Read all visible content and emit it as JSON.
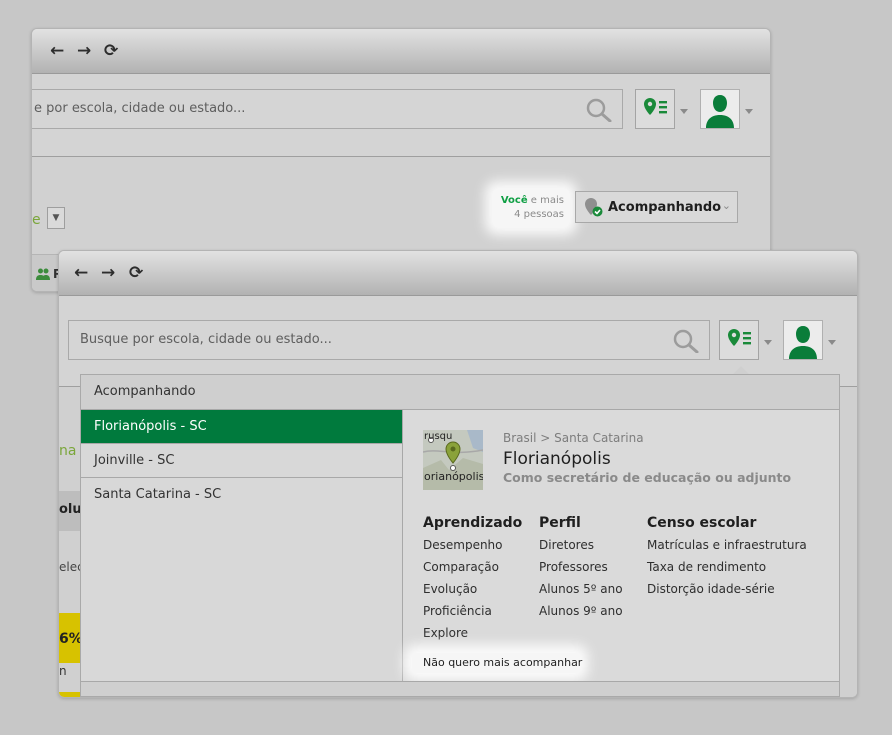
{
  "colors": {
    "accent": "#007a3d",
    "brand_green": "#009a3d",
    "chart_yellow": "#d7c200",
    "link_green": "#7aa63a"
  },
  "back_window": {
    "search": {
      "placeholder": "e por escola, cidade ou estado..."
    },
    "followers": {
      "you": "Você",
      "and_more": "e mais",
      "count": "4 pessoas"
    },
    "follow_button": {
      "label": "Acompanhando"
    },
    "cut_text": {
      "left_link": "e",
      "tab_letter": "P"
    }
  },
  "front_window": {
    "search": {
      "placeholder": "Busque por escola, cidade ou estado..."
    },
    "dropdown": {
      "header": "Acompanhando",
      "items": [
        {
          "label": "Florianópolis - SC",
          "selected": true
        },
        {
          "label": "Joinville - SC",
          "selected": false
        },
        {
          "label": "Santa Catarina - SC",
          "selected": false
        }
      ],
      "detail": {
        "breadcrumb": "Brasil > Santa Catarina",
        "city": "Florianópolis",
        "role": "Como secretário de educação ou adjunto",
        "map_labels": {
          "top": "rusqu",
          "bottom": "lorianópolis"
        },
        "columns": [
          {
            "title": "Aprendizado",
            "links": [
              "Desempenho",
              "Comparação",
              "Evolução",
              "Proficiência",
              "Explore"
            ]
          },
          {
            "title": "Perfil",
            "links": [
              "Diretores",
              "Professores",
              "Alunos 5º ano",
              "Alunos 9º ano"
            ]
          },
          {
            "title": "Censo escolar",
            "links": [
              "Matrículas e infraestrutura",
              "Taxa de rendimento",
              "Distorção idade-série"
            ]
          }
        ],
        "unfollow": "Não quero mais acompanhar"
      }
    },
    "background_snippets": {
      "link": "na c",
      "col_header": "olução",
      "select": "eleci",
      "percent": "6%",
      "small": "n"
    }
  }
}
